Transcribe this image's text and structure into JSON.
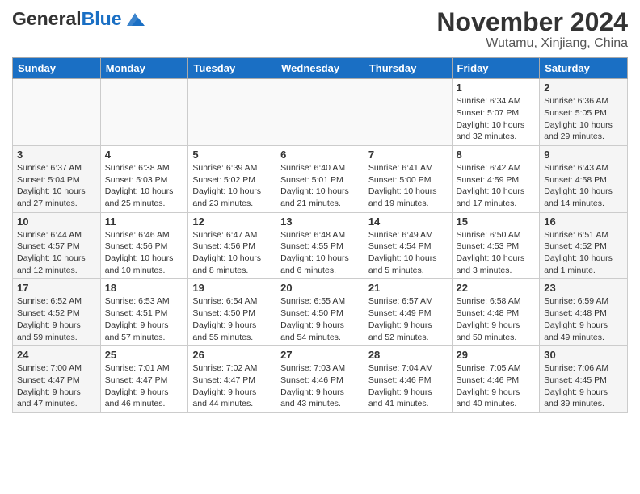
{
  "header": {
    "logo_general": "General",
    "logo_blue": "Blue",
    "month_title": "November 2024",
    "location": "Wutamu, Xinjiang, China"
  },
  "weekdays": [
    "Sunday",
    "Monday",
    "Tuesday",
    "Wednesday",
    "Thursday",
    "Friday",
    "Saturday"
  ],
  "weeks": [
    [
      {
        "day": "",
        "info": ""
      },
      {
        "day": "",
        "info": ""
      },
      {
        "day": "",
        "info": ""
      },
      {
        "day": "",
        "info": ""
      },
      {
        "day": "",
        "info": ""
      },
      {
        "day": "1",
        "info": "Sunrise: 6:34 AM\nSunset: 5:07 PM\nDaylight: 10 hours and 32 minutes."
      },
      {
        "day": "2",
        "info": "Sunrise: 6:36 AM\nSunset: 5:05 PM\nDaylight: 10 hours and 29 minutes."
      }
    ],
    [
      {
        "day": "3",
        "info": "Sunrise: 6:37 AM\nSunset: 5:04 PM\nDaylight: 10 hours and 27 minutes."
      },
      {
        "day": "4",
        "info": "Sunrise: 6:38 AM\nSunset: 5:03 PM\nDaylight: 10 hours and 25 minutes."
      },
      {
        "day": "5",
        "info": "Sunrise: 6:39 AM\nSunset: 5:02 PM\nDaylight: 10 hours and 23 minutes."
      },
      {
        "day": "6",
        "info": "Sunrise: 6:40 AM\nSunset: 5:01 PM\nDaylight: 10 hours and 21 minutes."
      },
      {
        "day": "7",
        "info": "Sunrise: 6:41 AM\nSunset: 5:00 PM\nDaylight: 10 hours and 19 minutes."
      },
      {
        "day": "8",
        "info": "Sunrise: 6:42 AM\nSunset: 4:59 PM\nDaylight: 10 hours and 17 minutes."
      },
      {
        "day": "9",
        "info": "Sunrise: 6:43 AM\nSunset: 4:58 PM\nDaylight: 10 hours and 14 minutes."
      }
    ],
    [
      {
        "day": "10",
        "info": "Sunrise: 6:44 AM\nSunset: 4:57 PM\nDaylight: 10 hours and 12 minutes."
      },
      {
        "day": "11",
        "info": "Sunrise: 6:46 AM\nSunset: 4:56 PM\nDaylight: 10 hours and 10 minutes."
      },
      {
        "day": "12",
        "info": "Sunrise: 6:47 AM\nSunset: 4:56 PM\nDaylight: 10 hours and 8 minutes."
      },
      {
        "day": "13",
        "info": "Sunrise: 6:48 AM\nSunset: 4:55 PM\nDaylight: 10 hours and 6 minutes."
      },
      {
        "day": "14",
        "info": "Sunrise: 6:49 AM\nSunset: 4:54 PM\nDaylight: 10 hours and 5 minutes."
      },
      {
        "day": "15",
        "info": "Sunrise: 6:50 AM\nSunset: 4:53 PM\nDaylight: 10 hours and 3 minutes."
      },
      {
        "day": "16",
        "info": "Sunrise: 6:51 AM\nSunset: 4:52 PM\nDaylight: 10 hours and 1 minute."
      }
    ],
    [
      {
        "day": "17",
        "info": "Sunrise: 6:52 AM\nSunset: 4:52 PM\nDaylight: 9 hours and 59 minutes."
      },
      {
        "day": "18",
        "info": "Sunrise: 6:53 AM\nSunset: 4:51 PM\nDaylight: 9 hours and 57 minutes."
      },
      {
        "day": "19",
        "info": "Sunrise: 6:54 AM\nSunset: 4:50 PM\nDaylight: 9 hours and 55 minutes."
      },
      {
        "day": "20",
        "info": "Sunrise: 6:55 AM\nSunset: 4:50 PM\nDaylight: 9 hours and 54 minutes."
      },
      {
        "day": "21",
        "info": "Sunrise: 6:57 AM\nSunset: 4:49 PM\nDaylight: 9 hours and 52 minutes."
      },
      {
        "day": "22",
        "info": "Sunrise: 6:58 AM\nSunset: 4:48 PM\nDaylight: 9 hours and 50 minutes."
      },
      {
        "day": "23",
        "info": "Sunrise: 6:59 AM\nSunset: 4:48 PM\nDaylight: 9 hours and 49 minutes."
      }
    ],
    [
      {
        "day": "24",
        "info": "Sunrise: 7:00 AM\nSunset: 4:47 PM\nDaylight: 9 hours and 47 minutes."
      },
      {
        "day": "25",
        "info": "Sunrise: 7:01 AM\nSunset: 4:47 PM\nDaylight: 9 hours and 46 minutes."
      },
      {
        "day": "26",
        "info": "Sunrise: 7:02 AM\nSunset: 4:47 PM\nDaylight: 9 hours and 44 minutes."
      },
      {
        "day": "27",
        "info": "Sunrise: 7:03 AM\nSunset: 4:46 PM\nDaylight: 9 hours and 43 minutes."
      },
      {
        "day": "28",
        "info": "Sunrise: 7:04 AM\nSunset: 4:46 PM\nDaylight: 9 hours and 41 minutes."
      },
      {
        "day": "29",
        "info": "Sunrise: 7:05 AM\nSunset: 4:46 PM\nDaylight: 9 hours and 40 minutes."
      },
      {
        "day": "30",
        "info": "Sunrise: 7:06 AM\nSunset: 4:45 PM\nDaylight: 9 hours and 39 minutes."
      }
    ]
  ]
}
